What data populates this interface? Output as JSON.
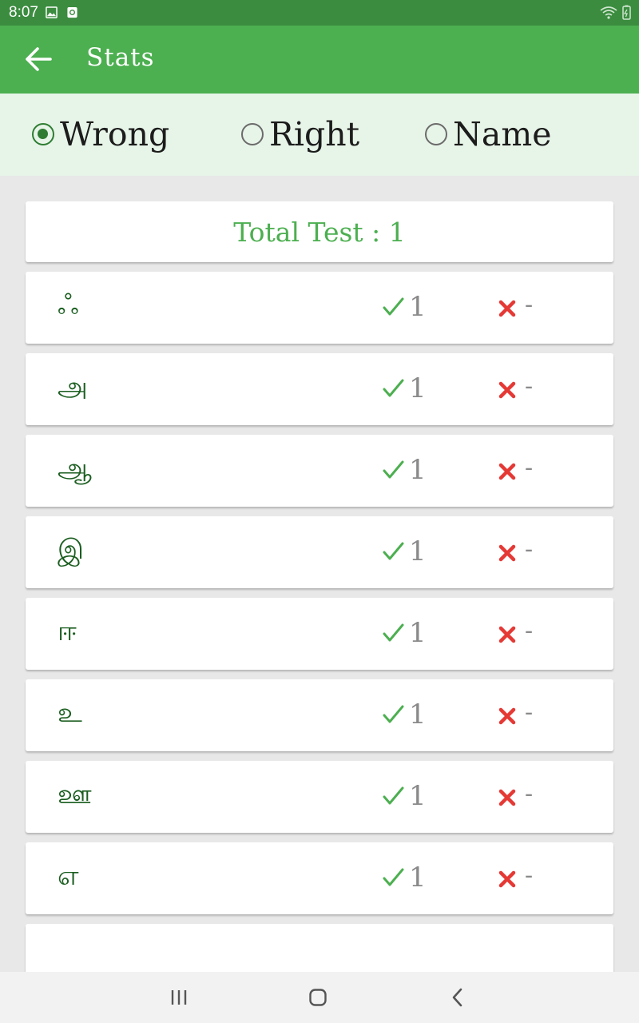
{
  "status_bar": {
    "time": "8:07"
  },
  "app_bar": {
    "title": "Stats"
  },
  "filter": {
    "options": [
      {
        "label": "Wrong",
        "checked": true
      },
      {
        "label": "Right",
        "checked": false
      },
      {
        "label": "Name",
        "checked": false
      }
    ]
  },
  "summary": {
    "total_text": "Total Test : 1"
  },
  "rows": [
    {
      "letter": "ஃ",
      "right": "1",
      "wrong": "-"
    },
    {
      "letter": "அ",
      "right": "1",
      "wrong": "-"
    },
    {
      "letter": "ஆ",
      "right": "1",
      "wrong": "-"
    },
    {
      "letter": "இ",
      "right": "1",
      "wrong": "-"
    },
    {
      "letter": "ஈ",
      "right": "1",
      "wrong": "-"
    },
    {
      "letter": "உ",
      "right": "1",
      "wrong": "-"
    },
    {
      "letter": "ஊ",
      "right": "1",
      "wrong": "-"
    },
    {
      "letter": "எ",
      "right": "1",
      "wrong": "-"
    }
  ],
  "colors": {
    "status_bar": "#3b8c3f",
    "app_bar": "#4caf50",
    "accent": "#2e7d32",
    "check": "#4caf50",
    "cross": "#e53935"
  },
  "icons": {
    "back": "arrow-back-icon",
    "check": "check-icon",
    "cross": "cross-icon",
    "nav_recents": "recents-icon",
    "nav_home": "home-icon",
    "nav_back": "nav-back-icon"
  }
}
